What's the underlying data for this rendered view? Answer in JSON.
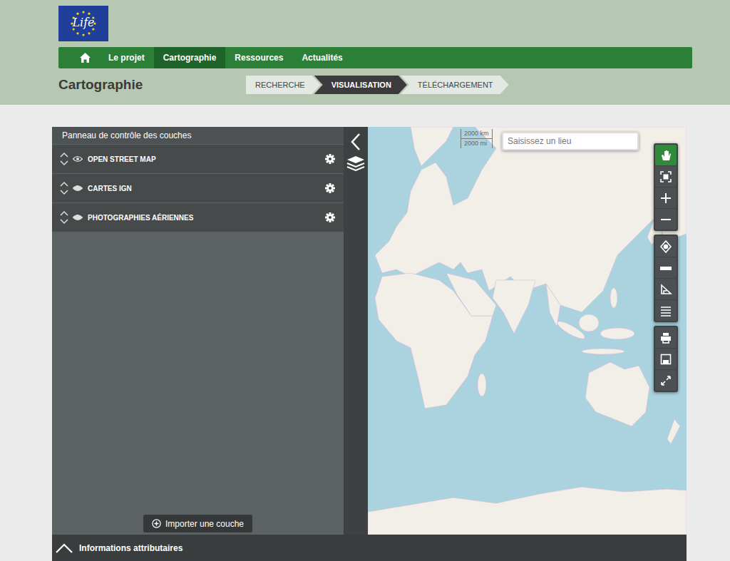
{
  "logo": {
    "text": "Life"
  },
  "nav": {
    "items": [
      {
        "label": "Le projet",
        "selected": false
      },
      {
        "label": "Cartographie",
        "selected": true
      },
      {
        "label": "Ressources",
        "selected": false
      },
      {
        "label": "Actualités",
        "selected": false
      }
    ]
  },
  "page": {
    "title": "Cartographie"
  },
  "steps": [
    {
      "label": "RECHERCHE",
      "selected": false
    },
    {
      "label": "VISUALISATION",
      "selected": true
    },
    {
      "label": "TÉLÉCHARGEMENT",
      "selected": false
    }
  ],
  "layer_panel": {
    "title": "Panneau de contrôle des couches",
    "layers": [
      {
        "name": "OPEN STREET MAP",
        "visible": true
      },
      {
        "name": "CARTES IGN",
        "visible": false
      },
      {
        "name": "PHOTOGRAPHIES AÉRIENNES",
        "visible": false
      }
    ],
    "import_button": "Importer une couche"
  },
  "map": {
    "search": {
      "placeholder": "Saisissez un lieu"
    },
    "scale": [
      "2000 km",
      "2000 mi"
    ]
  },
  "toolbar": {
    "groups": [
      [
        {
          "kind": "pan",
          "active": true
        },
        {
          "kind": "extent",
          "active": false
        },
        {
          "kind": "zoom-in",
          "active": false
        },
        {
          "kind": "zoom-out",
          "active": false
        }
      ],
      [
        {
          "kind": "locate",
          "active": false
        },
        {
          "kind": "ruler",
          "active": false
        },
        {
          "kind": "angle",
          "active": false
        },
        {
          "kind": "list",
          "active": false
        }
      ],
      [
        {
          "kind": "print",
          "active": false
        },
        {
          "kind": "save",
          "active": false
        },
        {
          "kind": "fullscreen",
          "active": false
        }
      ]
    ]
  },
  "attributes_bar": {
    "label": "Informations attributaires",
    "expanded": false
  }
}
